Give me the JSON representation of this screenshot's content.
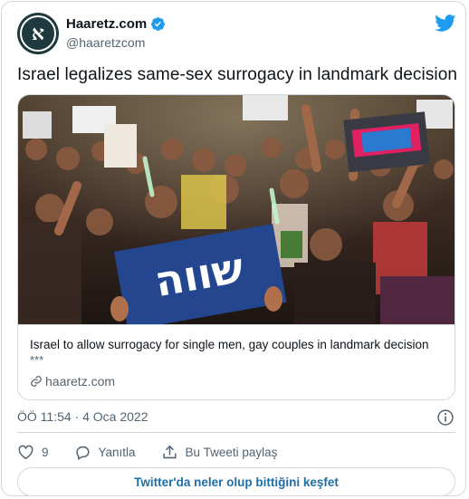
{
  "account": {
    "name": "Haaretz.com",
    "handle": "@haaretzcom",
    "verified": true,
    "avatar_letter": "א"
  },
  "tweet": {
    "text": "Israel legalizes same-sex surrogacy in landmark decision"
  },
  "link_card": {
    "title": "Israel to allow surrogacy for single men, gay couples in landmark decision",
    "description": "***",
    "domain": "haaretz.com",
    "sign_text": "שווה"
  },
  "meta": {
    "timestamp": "ÖÖ 11:54 · 4 Oca 2022"
  },
  "actions": {
    "like_count": "9",
    "reply_label": "Yanıtla",
    "share_label": "Bu Tweeti paylaş"
  },
  "footer": {
    "explore_label": "Twitter'da neler olup bittiğini keşfet"
  },
  "colors": {
    "verified_blue": "#1d9bf0",
    "text_primary": "#0f1419",
    "text_secondary": "#536471",
    "border": "#cfd9de",
    "link_button_text": "#1d6ea5"
  }
}
